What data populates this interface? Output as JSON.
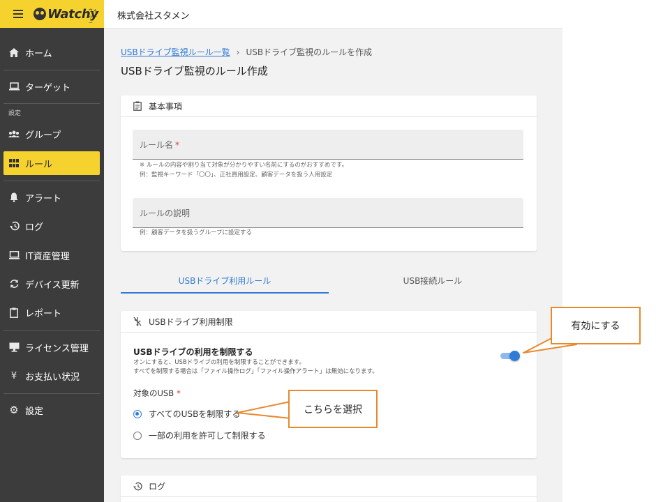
{
  "brand": {
    "name": "Watchy",
    "kana": "ウォッチー"
  },
  "header": {
    "company": "株式会社スタメン"
  },
  "sidebar": {
    "items": [
      {
        "label": "ホーム",
        "icon": "home-icon"
      },
      {
        "label": "ターゲット",
        "icon": "laptop-icon"
      },
      {
        "label": "グループ",
        "icon": "group-icon"
      },
      {
        "label": "ルール",
        "icon": "grid-icon"
      },
      {
        "label": "アラート",
        "icon": "bell-icon"
      },
      {
        "label": "ログ",
        "icon": "history-icon"
      },
      {
        "label": "IT資産管理",
        "icon": "computer-icon"
      },
      {
        "label": "デバイス更新",
        "icon": "refresh-icon"
      },
      {
        "label": "レポート",
        "icon": "clipboard-icon"
      },
      {
        "label": "ライセンス管理",
        "icon": "monitor-icon"
      },
      {
        "label": "お支払い状況",
        "icon": "yen-icon"
      },
      {
        "label": "設定",
        "icon": "gear-icon"
      }
    ],
    "section_label": "設定",
    "active": "ルール"
  },
  "breadcrumb": {
    "link": "USBドライブ監視ルール一覧",
    "separator": "›",
    "current": "USBドライブ監視のルールを作成"
  },
  "page_title": "USBドライブ監視のルール作成",
  "basic": {
    "title": "基本事項",
    "rule_name_label": "ルール名",
    "required_mark": "*",
    "rule_name_hint1": "※ ルールの内容や割り当て対象が分かりやすい名前にするのがおすすめです。",
    "rule_name_hint2": "例：監視キーワード「〇〇」、正社員用設定、顧客データを扱う人用設定",
    "desc_label": "ルールの説明",
    "desc_hint": "例：顧客データを扱うグループに設定する"
  },
  "tabs": [
    {
      "label": "USBドライブ利用ルール",
      "active": true
    },
    {
      "label": "USB接続ルール",
      "active": false
    }
  ],
  "usb_limit": {
    "title": "USBドライブ利用制限",
    "option_title": "USBドライブの利用を制限する",
    "option_desc1": "オンにすると、USBドライブの利用を制限することができます。",
    "option_desc2": "すべてを制限する場合は「ファイル操作ログ」「ファイル操作アラート」は無効になります。",
    "toggle_on": true,
    "target_label": "対象のUSB",
    "required_mark": "*",
    "radio_all": "すべてのUSBを制限する",
    "radio_partial": "一部の利用を許可して制限する",
    "selected": "all"
  },
  "log_card": {
    "title": "ログ"
  },
  "callouts": {
    "enable": "有効にする",
    "select": "こちらを選択"
  },
  "colors": {
    "accent": "#2f7bd6",
    "brand_yellow": "#f6d22f",
    "sidebar": "#3c3c3c",
    "callout_border": "#e8892c",
    "required": "#d63a3a"
  }
}
